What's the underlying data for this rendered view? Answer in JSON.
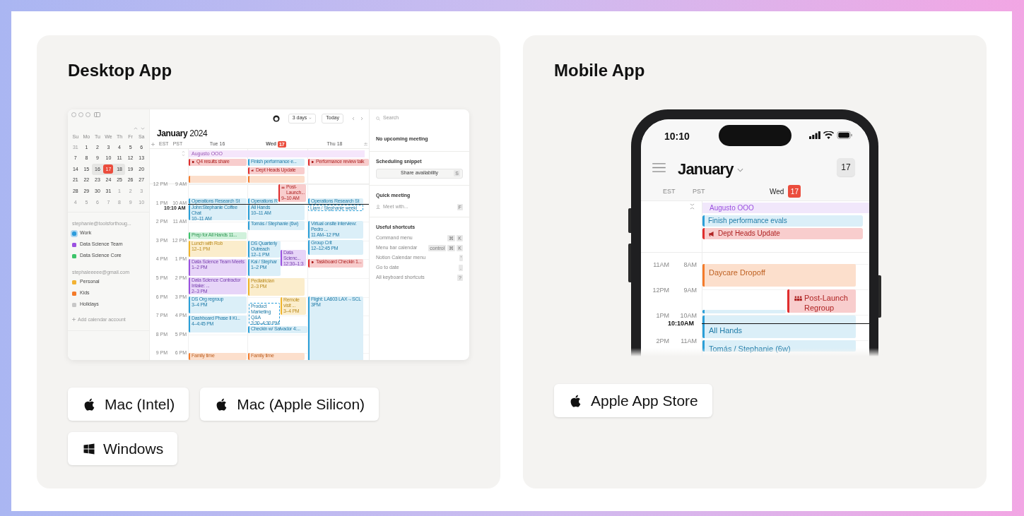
{
  "desktop_card": {
    "title": "Desktop App",
    "app": {
      "sidebar": {
        "weekdays": [
          "Su",
          "Mo",
          "Tu",
          "We",
          "Th",
          "Fr",
          "Sa"
        ],
        "weeks": [
          {
            "days": [
              {
                "day": "31",
                "muted": true,
                "selected": false,
                "in_range": false
              },
              {
                "day": "1",
                "muted": false,
                "selected": false,
                "in_range": false
              },
              {
                "day": "2",
                "muted": false,
                "selected": false,
                "in_range": false
              },
              {
                "day": "3",
                "muted": false,
                "selected": false,
                "in_range": false
              },
              {
                "day": "4",
                "muted": false,
                "selected": false,
                "in_range": false
              },
              {
                "day": "5",
                "muted": false,
                "selected": false,
                "in_range": false
              },
              {
                "day": "6",
                "muted": false,
                "selected": false,
                "in_range": false
              }
            ]
          },
          {
            "days": [
              {
                "day": "7",
                "muted": false,
                "selected": false,
                "in_range": false
              },
              {
                "day": "8",
                "muted": false,
                "selected": false,
                "in_range": false
              },
              {
                "day": "9",
                "muted": false,
                "selected": false,
                "in_range": false
              },
              {
                "day": "10",
                "muted": false,
                "selected": false,
                "in_range": false
              },
              {
                "day": "11",
                "muted": false,
                "selected": false,
                "in_range": false
              },
              {
                "day": "12",
                "muted": false,
                "selected": false,
                "in_range": false
              },
              {
                "day": "13",
                "muted": false,
                "selected": false,
                "in_range": false
              }
            ]
          },
          {
            "days": [
              {
                "day": "14",
                "muted": false,
                "selected": false,
                "in_range": false
              },
              {
                "day": "15",
                "muted": false,
                "selected": false,
                "in_range": false
              },
              {
                "day": "16",
                "muted": false,
                "selected": false,
                "in_range": true
              },
              {
                "day": "17",
                "muted": false,
                "selected": true,
                "in_range": true
              },
              {
                "day": "18",
                "muted": false,
                "selected": false,
                "in_range": true
              },
              {
                "day": "19",
                "muted": false,
                "selected": false,
                "in_range": false
              },
              {
                "day": "20",
                "muted": false,
                "selected": false,
                "in_range": false
              }
            ]
          },
          {
            "days": [
              {
                "day": "21",
                "muted": false,
                "selected": false,
                "in_range": false
              },
              {
                "day": "22",
                "muted": false,
                "selected": false,
                "in_range": false
              },
              {
                "day": "23",
                "muted": false,
                "selected": false,
                "in_range": false
              },
              {
                "day": "24",
                "muted": false,
                "selected": false,
                "in_range": false
              },
              {
                "day": "25",
                "muted": false,
                "selected": false,
                "in_range": false
              },
              {
                "day": "26",
                "muted": false,
                "selected": false,
                "in_range": false
              },
              {
                "day": "27",
                "muted": false,
                "selected": false,
                "in_range": false
              }
            ]
          },
          {
            "days": [
              {
                "day": "28",
                "muted": false,
                "selected": false,
                "in_range": false
              },
              {
                "day": "29",
                "muted": false,
                "selected": false,
                "in_range": false
              },
              {
                "day": "30",
                "muted": false,
                "selected": false,
                "in_range": false
              },
              {
                "day": "31",
                "muted": false,
                "selected": false,
                "in_range": false
              },
              {
                "day": "1",
                "muted": true,
                "selected": false,
                "in_range": false
              },
              {
                "day": "2",
                "muted": true,
                "selected": false,
                "in_range": false
              },
              {
                "day": "3",
                "muted": true,
                "selected": false,
                "in_range": false
              }
            ]
          },
          {
            "days": [
              {
                "day": "4",
                "muted": true,
                "selected": false,
                "in_range": false
              },
              {
                "day": "5",
                "muted": true,
                "selected": false,
                "in_range": false
              },
              {
                "day": "6",
                "muted": true,
                "selected": false,
                "in_range": false
              },
              {
                "day": "7",
                "muted": true,
                "selected": false,
                "in_range": false
              },
              {
                "day": "8",
                "muted": true,
                "selected": false,
                "in_range": false
              },
              {
                "day": "9",
                "muted": true,
                "selected": false,
                "in_range": false
              },
              {
                "day": "10",
                "muted": true,
                "selected": false,
                "in_range": false
              }
            ]
          }
        ],
        "accounts": [
          {
            "email": "stephanie@toolsforthoug...",
            "calendars": [
              {
                "name": "Work",
                "color": "#2d9cdb",
                "selected": true
              },
              {
                "name": "Data Science Team",
                "color": "#9b51e0",
                "selected": false
              },
              {
                "name": "Data Science Core",
                "color": "#3cc46a",
                "selected": false
              }
            ]
          },
          {
            "email": "stephaleeeee@gmail.com",
            "calendars": [
              {
                "name": "Personal",
                "color": "#f2b233",
                "selected": false
              },
              {
                "name": "Kids",
                "color": "#f47b2a",
                "selected": false
              },
              {
                "name": "Holidays",
                "color": "#c8c8c8",
                "selected": false
              }
            ]
          }
        ],
        "add_account": "Add calendar account"
      },
      "toolbar": {
        "view": "3 days",
        "today": "Today"
      },
      "month": "January",
      "year": "2024",
      "timezones": [
        "EST",
        "PST"
      ],
      "days": [
        {
          "weekday": "Tue",
          "date": "16",
          "today": false
        },
        {
          "weekday": "Wed",
          "date": "17",
          "today": true
        },
        {
          "weekday": "Thu",
          "date": "18",
          "today": false
        }
      ],
      "hours": [
        {
          "est": "12 PM",
          "pst": "9 AM"
        },
        {
          "est": "1 PM",
          "pst": "10 AM"
        },
        {
          "est": "2 PM",
          "pst": "11 AM"
        },
        {
          "est": "3 PM",
          "pst": "12 PM"
        },
        {
          "est": "4 PM",
          "pst": "1 PM"
        },
        {
          "est": "5 PM",
          "pst": "2 PM"
        },
        {
          "est": "6 PM",
          "pst": "3 PM"
        },
        {
          "est": "7 PM",
          "pst": "4 PM"
        },
        {
          "est": "8 PM",
          "pst": "5 PM"
        },
        {
          "est": "9 PM",
          "pst": "6 PM"
        }
      ],
      "current_time": "10:10 AM",
      "all_day_banner": {
        "title": "Augusto OOO",
        "color": "#f5e6fb"
      },
      "columns": [
        {
          "events": [
            {
              "title": "Q4 results share",
              "color": "#e02d2d",
              "kind": "solid"
            },
            {
              "color": "#f47b2a",
              "kind": "solid"
            },
            {
              "title": "Operations Research St",
              "color": "#2a9fd8",
              "kind": "solid"
            },
            {
              "title": "John:Stephanie Coffee Chat",
              "time": "10–11 AM",
              "color": "#2a9fd8",
              "kind": "solid"
            },
            {
              "title": "Prep for All Hands 11...",
              "color": "#3cc46a",
              "kind": "solid"
            },
            {
              "title": "Lunch with Rob",
              "time": "12–1 PM",
              "color": "#f0b429",
              "kind": "solid"
            },
            {
              "title": "Data Science Team Meets",
              "time": "1–2 PM",
              "color": "#9b51e0",
              "kind": "solid"
            },
            {
              "title": "Data Science Contractor Intake: ...",
              "time": "2–3 PM",
              "color": "#9b51e0",
              "kind": "solid"
            },
            {
              "title": "DS Org regroup",
              "time": "3–4 PM",
              "color": "#2a9fd8",
              "kind": "solid"
            },
            {
              "title": "Dashboard Phase II Ki...",
              "time": "4–4:45 PM",
              "color": "#2a9fd8",
              "kind": "solid"
            },
            {
              "title": "Family time",
              "color": "#f47b2a",
              "kind": "solid"
            }
          ]
        },
        {
          "events": [
            {
              "title": "Finish performance e...",
              "color": "#2a9fd8",
              "kind": "solid"
            },
            {
              "title": "Dept Heads Update",
              "color": "#e02d2d",
              "kind": "solid"
            },
            {
              "color": "#f47b2a",
              "kind": "solid"
            },
            {
              "title": "Post-Launch...",
              "time": "9–10 AM",
              "color": "#e02d2d",
              "kind": "solid"
            },
            {
              "title": "Operations R",
              "color": "#2a9fd8",
              "kind": "solid"
            },
            {
              "title": "All Hands",
              "time": "10–11 AM",
              "color": "#2a9fd8",
              "kind": "solid"
            },
            {
              "title": "Tomás / Stephanie (6w)",
              "color": "#2a9fd8",
              "kind": "solid"
            },
            {
              "title": "DS Quarterly Outreach",
              "time": "12–1 PM",
              "color": "#2a9fd8",
              "kind": "solid"
            },
            {
              "title": "Data Scienc...",
              "time": "12:30–1:3",
              "color": "#9b51e0",
              "kind": "solid"
            },
            {
              "title": "Kai / Stephar",
              "time": "1–2 PM",
              "color": "#2a9fd8",
              "kind": "solid"
            },
            {
              "title": "Pediatrician",
              "time": "2–3 PM",
              "color": "#f0b429",
              "kind": "solid"
            },
            {
              "title": "Remote visit ...",
              "time": "3–4 PM",
              "color": "#f0b429",
              "kind": "solid"
            },
            {
              "title": "Product Marketing Q&A",
              "time": "3:30–4:30 PM",
              "color": "#2a9fd8",
              "kind": "dashed"
            },
            {
              "title": "Checkin w/ Salvador 4:...",
              "color": "#2a9fd8",
              "kind": "solid"
            },
            {
              "title": "Family time",
              "color": "#f47b2a",
              "kind": "solid"
            }
          ]
        },
        {
          "events": [
            {
              "title": "Performance review talk",
              "color": "#e02d2d",
              "kind": "solid"
            },
            {
              "title": "Operations Research St",
              "color": "#2a9fd8",
              "kind": "solid"
            },
            {
              "title": "Liam / Stephanie weekl",
              "color": "#2a9fd8",
              "kind": "dashed"
            },
            {
              "title": "Virtual onsite interview: Pedro ...",
              "time": "11 AM–12 PM",
              "color": "#2a9fd8",
              "kind": "solid"
            },
            {
              "title": "Group Crit",
              "time": "12–12:45 PM",
              "color": "#2a9fd8",
              "kind": "solid"
            },
            {
              "title": "Taskboard Checkin 1...",
              "color": "#e02d2d",
              "kind": "solid"
            },
            {
              "title": "Flight: LA603 LAX→SCL",
              "time": "3PM",
              "color": "#2a9fd8",
              "kind": "solid"
            }
          ]
        }
      ],
      "side_panel": {
        "search": {
          "placeholder": "Search"
        },
        "status": "No upcoming meeting",
        "scheduling": {
          "heading": "Scheduling snippet",
          "button": "Share availability",
          "key": "S"
        },
        "quick_meeting": {
          "heading": "Quick meeting",
          "placeholder": "Meet with...",
          "key": "F"
        },
        "shortcuts": {
          "heading": "Useful shortcuts",
          "items": [
            {
              "label": "Command menu",
              "keys": [
                "⌘",
                "K"
              ]
            },
            {
              "label": "Menu bar calendar",
              "keys": [
                "control",
                "⌘",
                "K"
              ]
            },
            {
              "label": "Notion Calendar menu",
              "keys": [
                "'"
              ]
            },
            {
              "label": "Go to date",
              "keys": [
                "."
              ]
            },
            {
              "label": "All keyboard shortcuts",
              "keys": [
                "?"
              ]
            }
          ]
        }
      }
    },
    "buttons": [
      {
        "label": "Mac (Intel)",
        "kind": "apple"
      },
      {
        "label": "Mac (Apple Silicon)",
        "kind": "apple"
      },
      {
        "label": "Windows",
        "kind": "windows"
      }
    ]
  },
  "mobile_card": {
    "title": "Mobile App",
    "phone": {
      "status_time": "10:10",
      "month": "January",
      "today_button": "17",
      "timezones": [
        "EST",
        "PST"
      ],
      "day": {
        "weekday": "Wed",
        "date": "17",
        "today": true
      },
      "all_day_events": [
        {
          "title": "Augusto OOO",
          "color": "#9b51e0",
          "kind": "banner"
        },
        {
          "title": "Finish performance evals",
          "color": "#2a9fd8",
          "kind": "solid"
        },
        {
          "title": "Dept Heads Update",
          "color": "#e02d2d",
          "kind": "solid"
        }
      ],
      "hours": [
        {
          "est": "11AM",
          "pst": "8AM"
        },
        {
          "est": "12PM",
          "pst": "9AM"
        },
        {
          "est": "1PM",
          "pst": "10AM"
        },
        {
          "est": "2PM",
          "pst": "11AM"
        }
      ],
      "current_time": "10:10AM",
      "events": [
        {
          "title": "Daycare Dropoff",
          "color": "#f47b2a",
          "kind": "solid"
        },
        {
          "title": "Post-Launch Regroup",
          "color": "#e02d2d",
          "kind": "solid"
        },
        {
          "color": "#2a9fd8",
          "kind": "solid"
        },
        {
          "title": "All Hands",
          "color": "#2a9fd8",
          "kind": "solid"
        },
        {
          "title": "Tomás / Stephanie (6w)",
          "color": "#2a9fd8",
          "kind": "solid"
        }
      ]
    },
    "buttons": [
      {
        "label": "Apple App Store",
        "kind": "apple"
      }
    ]
  }
}
